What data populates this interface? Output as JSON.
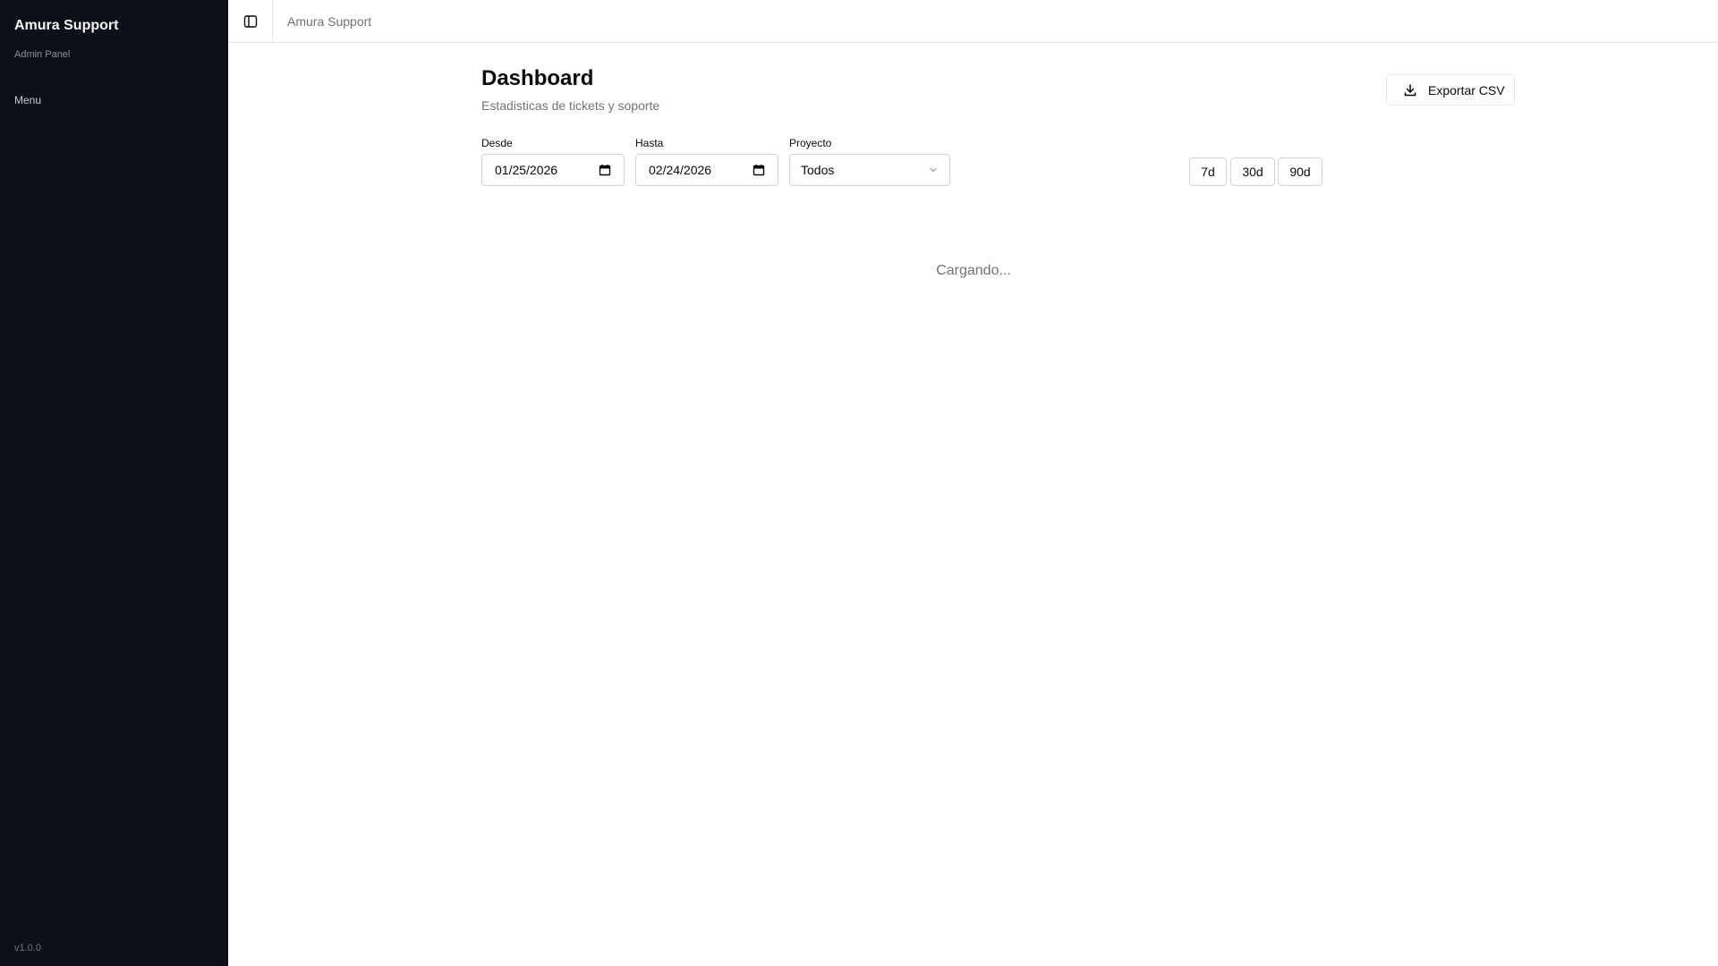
{
  "sidebar": {
    "brand_title": "Amura Support",
    "brand_subtitle": "Admin Panel",
    "menu_label": "Menu",
    "version": "v1.0.0"
  },
  "topbar": {
    "toggle_icon": "sidebar-panel-icon",
    "title": "Amura Support"
  },
  "page": {
    "title": "Dashboard",
    "subtitle": "Estadisticas de tickets y soporte",
    "export_label": "Exportar CSV",
    "export_icon": "download-icon"
  },
  "filters": {
    "from_label": "Desde",
    "from_value": "01/25/2026",
    "to_label": "Hasta",
    "to_value": "02/24/2026",
    "project_label": "Proyecto",
    "project_value": "Todos",
    "ranges": [
      "7d",
      "30d",
      "90d"
    ]
  },
  "status": {
    "loading": "Cargando..."
  },
  "colors": {
    "sidebar_bg": "#0d1117",
    "muted_text": "#737373",
    "border": "#e5e7eb"
  }
}
